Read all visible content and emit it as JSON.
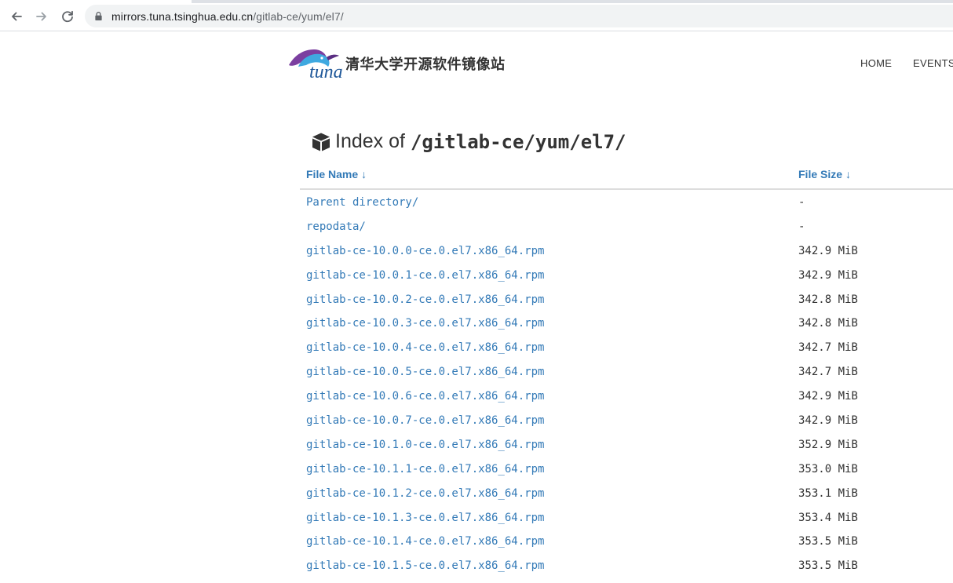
{
  "browser": {
    "url_host": "mirrors.tuna.tsinghua.edu.cn",
    "url_path": "/gitlab-ce/yum/el7/"
  },
  "site": {
    "logo_text": "tuna",
    "title": "清华大学开源软件镜像站",
    "nav": [
      "HOME",
      "EVENTS"
    ]
  },
  "index": {
    "prefix": "Index of",
    "path": "/gitlab-ce/yum/el7/"
  },
  "table": {
    "col_name": "File Name",
    "col_size": "File Size",
    "sort_arrow": "↓",
    "rows": [
      {
        "name": "Parent directory/",
        "size": "-"
      },
      {
        "name": "repodata/",
        "size": "-"
      },
      {
        "name": "gitlab-ce-10.0.0-ce.0.el7.x86_64.rpm",
        "size": "342.9 MiB"
      },
      {
        "name": "gitlab-ce-10.0.1-ce.0.el7.x86_64.rpm",
        "size": "342.9 MiB"
      },
      {
        "name": "gitlab-ce-10.0.2-ce.0.el7.x86_64.rpm",
        "size": "342.8 MiB"
      },
      {
        "name": "gitlab-ce-10.0.3-ce.0.el7.x86_64.rpm",
        "size": "342.8 MiB"
      },
      {
        "name": "gitlab-ce-10.0.4-ce.0.el7.x86_64.rpm",
        "size": "342.7 MiB"
      },
      {
        "name": "gitlab-ce-10.0.5-ce.0.el7.x86_64.rpm",
        "size": "342.7 MiB"
      },
      {
        "name": "gitlab-ce-10.0.6-ce.0.el7.x86_64.rpm",
        "size": "342.9 MiB"
      },
      {
        "name": "gitlab-ce-10.0.7-ce.0.el7.x86_64.rpm",
        "size": "342.9 MiB"
      },
      {
        "name": "gitlab-ce-10.1.0-ce.0.el7.x86_64.rpm",
        "size": "352.9 MiB"
      },
      {
        "name": "gitlab-ce-10.1.1-ce.0.el7.x86_64.rpm",
        "size": "353.0 MiB"
      },
      {
        "name": "gitlab-ce-10.1.2-ce.0.el7.x86_64.rpm",
        "size": "353.1 MiB"
      },
      {
        "name": "gitlab-ce-10.1.3-ce.0.el7.x86_64.rpm",
        "size": "353.4 MiB"
      },
      {
        "name": "gitlab-ce-10.1.4-ce.0.el7.x86_64.rpm",
        "size": "353.5 MiB"
      },
      {
        "name": "gitlab-ce-10.1.5-ce.0.el7.x86_64.rpm",
        "size": "353.5 MiB"
      }
    ]
  },
  "colors": {
    "link": "#337ab7",
    "text": "#333333",
    "logo_purple": "#7b3fa0",
    "logo_blue": "#3fa9e0"
  },
  "icons": {
    "back": "arrow-left-icon",
    "forward": "arrow-right-icon",
    "reload": "reload-icon",
    "lock": "lock-icon",
    "index": "cube-icon"
  }
}
